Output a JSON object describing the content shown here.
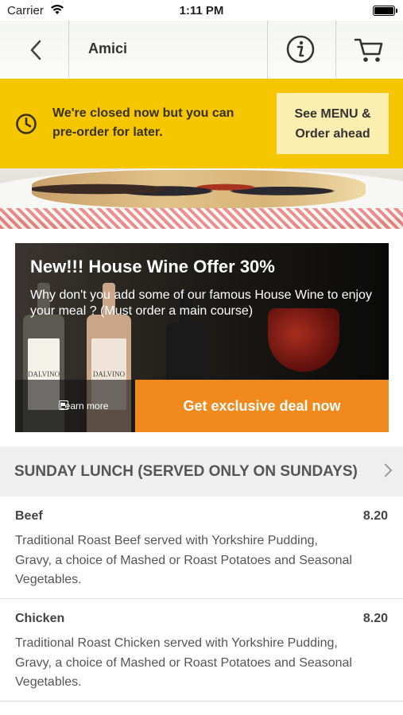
{
  "status_bar": {
    "carrier": "Carrier",
    "time": "1:11 PM"
  },
  "header": {
    "title": "Amici"
  },
  "notice": {
    "message": "We're closed now but you can pre-order for later.",
    "cta_line1": "See MENU &",
    "cta_line2": "Order ahead"
  },
  "promo": {
    "title": "New!!! House Wine Offer 30%",
    "description": "Why don't you add some of our famous House Wine to enjoy your meal ? (Must order a main course)",
    "learn_more": "Learn more",
    "deal_button": "Get exclusive deal now",
    "bottle_brand": "DALVINO"
  },
  "menu": {
    "section_title": "SUNDAY LUNCH (SERVED ONLY ON SUNDAYS)",
    "items": [
      {
        "name": "Beef",
        "price": "8.20",
        "description": "Traditional Roast Beef served with Yorkshire Pudding, Gravy, a choice of Mashed or Roast Potatoes and Seasonal Vegetables."
      },
      {
        "name": "Chicken",
        "price": "8.20",
        "description": "Traditional Roast Chicken served with Yorkshire Pudding, Gravy, a choice of Mashed or Roast Potatoes and Seasonal Vegetables."
      }
    ]
  },
  "colors": {
    "banner": "#f6c700",
    "cta_bg": "#fbeeb0",
    "deal_button": "#f08a1c",
    "section_bg": "#efefef"
  },
  "icons": [
    "wifi-icon",
    "battery-icon",
    "back-chevron-icon",
    "info-icon",
    "cart-icon",
    "clock-icon",
    "learn-more-icon",
    "chevron-right-icon"
  ]
}
